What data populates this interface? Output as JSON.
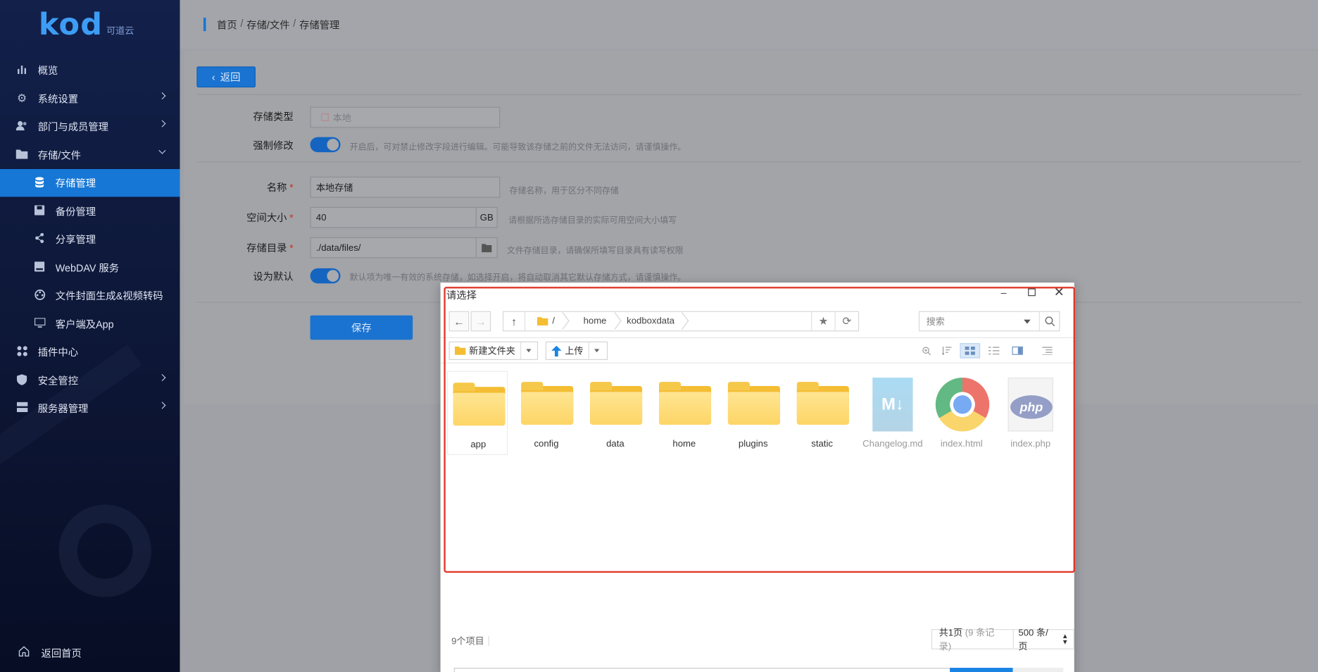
{
  "sidebar": {
    "logo_main": "kod",
    "logo_sub": "可道云",
    "items": [
      {
        "label": "概览",
        "icon": "bar-chart-icon"
      },
      {
        "label": "系统设置",
        "icon": "gear-icon"
      },
      {
        "label": "部门与成员管理",
        "icon": "users-icon"
      },
      {
        "label": "存储/文件",
        "icon": "folder-icon"
      },
      {
        "label": "存储管理",
        "icon": "database-icon"
      },
      {
        "label": "备份管理",
        "icon": "save-icon"
      },
      {
        "label": "分享管理",
        "icon": "share-icon"
      },
      {
        "label": "WebDAV 服务",
        "icon": "drive-icon"
      },
      {
        "label": "文件封面生成&视频转码",
        "icon": "film-icon"
      },
      {
        "label": "客户端及App",
        "icon": "monitor-icon"
      },
      {
        "label": "插件中心",
        "icon": "plugin-icon"
      },
      {
        "label": "安全管控",
        "icon": "shield-icon"
      },
      {
        "label": "服务器管理",
        "icon": "server-icon"
      }
    ],
    "bottom": "返回首页"
  },
  "breadcrumb": [
    "首页",
    "存储/文件",
    "存储管理"
  ],
  "form": {
    "back_label": "返回",
    "type_label": "存储类型",
    "type_value": "本地",
    "force_label": "强制修改",
    "force_hint": "开启后，可对禁止修改字段进行编辑。可能导致该存储之前的文件无法访问，请谨慎操作。",
    "name_label": "名称",
    "name_value": "本地存储",
    "name_hint": "存储名称，用于区分不同存储",
    "size_label": "空间大小",
    "size_value": "40",
    "size_unit": "GB",
    "size_hint": "请根据所选存储目录的实际可用空间大小填写",
    "dir_label": "存储目录",
    "dir_value": "./data/files/",
    "dir_hint": "文件存储目录，请确保所填写目录具有读写权限",
    "default_label": "设为默认",
    "default_hint": "默认项为唯一有效的系统存储，如选择开启，将自动取消其它默认存储方式，请谨慎操作。",
    "save_label": "保存",
    "required_mark": "*"
  },
  "dialog": {
    "title": "请选择",
    "path": [
      "/",
      "home",
      "kodboxdata"
    ],
    "search_placeholder": "搜索",
    "new_folder": "新建文件夹",
    "upload": "上传",
    "files": [
      {
        "name": "app",
        "kind": "folder"
      },
      {
        "name": "config",
        "kind": "folder"
      },
      {
        "name": "data",
        "kind": "folder"
      },
      {
        "name": "home",
        "kind": "folder"
      },
      {
        "name": "plugins",
        "kind": "folder"
      },
      {
        "name": "static",
        "kind": "folder"
      },
      {
        "name": "Changelog.md",
        "kind": "markdown"
      },
      {
        "name": "index.html",
        "kind": "html"
      },
      {
        "name": "index.php",
        "kind": "php"
      }
    ],
    "item_count": "9个项目",
    "pages": "共1页",
    "records": "(9 条记录)",
    "per_page": "500 条/页"
  },
  "colors": {
    "accent": "#1677d6",
    "highlight": "#e0392b"
  }
}
